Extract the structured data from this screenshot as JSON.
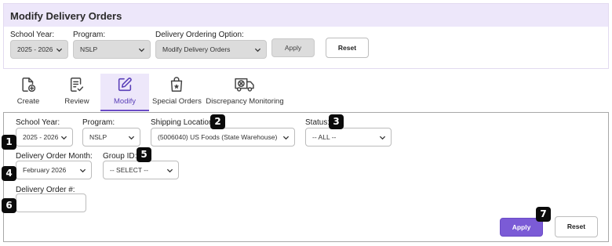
{
  "header": {
    "title": "Modify Delivery Orders",
    "school_year_label": "School Year:",
    "school_year_value": "2025 - 2026",
    "program_label": "Program:",
    "program_value": "NSLP",
    "ordering_option_label": "Delivery Ordering Option:",
    "ordering_option_value": "Modify Delivery Orders",
    "apply_label": "Apply",
    "reset_label": "Reset"
  },
  "tabs": [
    {
      "label": "Create",
      "icon": "file-plus-icon",
      "active": false
    },
    {
      "label": "Review",
      "icon": "file-check-icon",
      "active": false
    },
    {
      "label": "Modify",
      "icon": "edit-square-icon",
      "active": true
    },
    {
      "label": "Special Orders",
      "icon": "shopping-bag-star-icon",
      "active": false
    },
    {
      "label": "Discrepancy Monitoring",
      "icon": "delivery-truck-x-icon",
      "active": false
    }
  ],
  "form": {
    "school_year_label": "School Year:",
    "school_year_value": "2025 - 2026",
    "program_label": "Program:",
    "program_value": "NSLP",
    "shipping_location_label": "Shipping Location:",
    "shipping_location_value": "(5006040) US Foods (State Warehouse)",
    "status_label": "Status:",
    "status_value": "-- ALL --",
    "delivery_month_label": "Delivery Order Month:",
    "delivery_month_value": "February 2026",
    "group_id_label": "Group ID:",
    "group_id_value": "-- SELECT --",
    "delivery_order_number_label": "Delivery Order #:",
    "delivery_order_number_value": "",
    "apply_label": "Apply",
    "reset_label": "Reset"
  },
  "callouts": [
    "1",
    "2",
    "3",
    "4",
    "5",
    "6",
    "7"
  ],
  "colors": {
    "accent": "#7b5bd6",
    "header_bg": "#ede7fa",
    "callout_bg": "#0b0b0b"
  }
}
